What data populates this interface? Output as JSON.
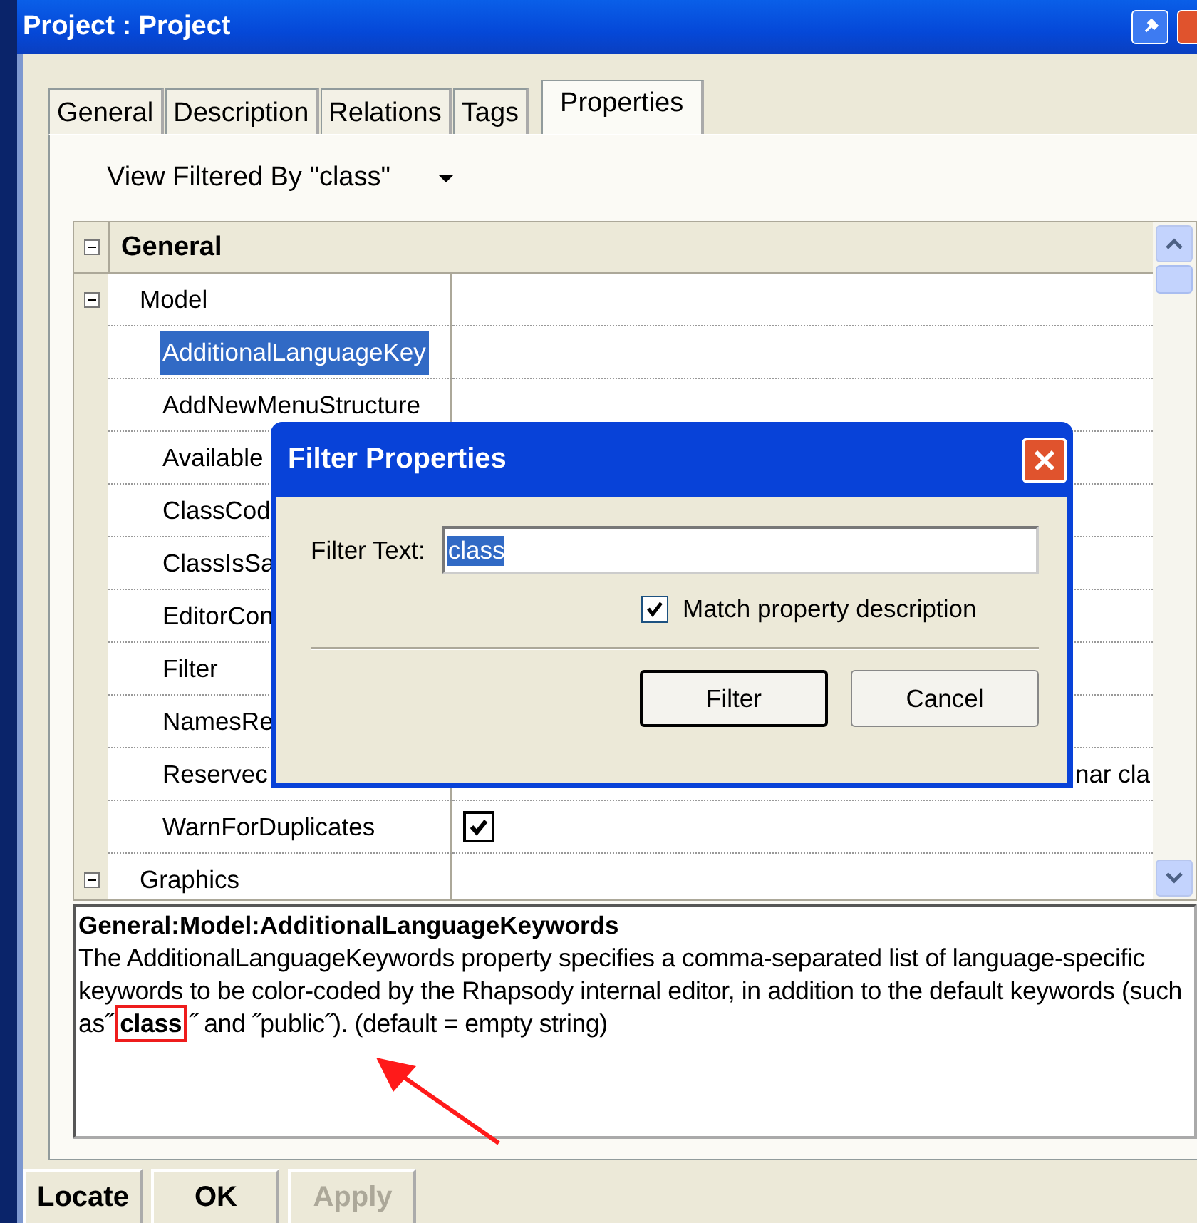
{
  "window": {
    "title": "Project : Project"
  },
  "tabs": [
    {
      "label": "General",
      "selected": false
    },
    {
      "label": "Description",
      "selected": false
    },
    {
      "label": "Relations",
      "selected": false
    },
    {
      "label": "Tags",
      "selected": false
    },
    {
      "label": "Properties",
      "selected": true
    }
  ],
  "view_filter": {
    "label": "View Filtered By \"class\""
  },
  "grid": {
    "rows": [
      {
        "kind": "category",
        "name": "General",
        "expanded": true
      },
      {
        "kind": "group",
        "name": "Model",
        "expanded": true
      },
      {
        "kind": "property",
        "name": "AdditionalLanguageKey",
        "selected": true
      },
      {
        "kind": "property",
        "name": "AddNewMenuStructure",
        "selected": false
      },
      {
        "kind": "property",
        "name": "Available",
        "selected": false
      },
      {
        "kind": "property",
        "name": "ClassCod",
        "selected": false
      },
      {
        "kind": "property",
        "name": "ClassIsSa",
        "selected": false
      },
      {
        "kind": "property",
        "name": "EditorCon",
        "selected": false
      },
      {
        "kind": "property",
        "name": "Filter",
        "selected": false
      },
      {
        "kind": "property",
        "name": "NamesRe",
        "selected": false
      },
      {
        "kind": "property",
        "name": "Reservec",
        "selected": false,
        "value": "nar cla"
      },
      {
        "kind": "property",
        "name": "WarnForDuplicates",
        "selected": false,
        "checked": true
      },
      {
        "kind": "group",
        "name": "Graphics",
        "expanded": true
      }
    ]
  },
  "description": {
    "heading": "General:Model:AdditionalLanguageKeywords",
    "text": "The  AdditionalLanguageKeywords property specifies a comma-separated list of language-specific keywords to be color-coded by the Rhapsody internal editor, in addition to the default keywords (such as˝**class**˝ and ˝public˝). (default = empty string)"
  },
  "buttons": [
    {
      "label": "Locate",
      "disabled": false
    },
    {
      "label": "OK",
      "disabled": false
    },
    {
      "label": "Apply",
      "disabled": true
    }
  ],
  "dialog": {
    "title": "Filter Properties",
    "filter_label": "Filter Text:",
    "filter_value": "class",
    "match_description": {
      "label": "Match property description",
      "checked": true
    },
    "buttons": [
      "Filter",
      "Cancel"
    ]
  }
}
